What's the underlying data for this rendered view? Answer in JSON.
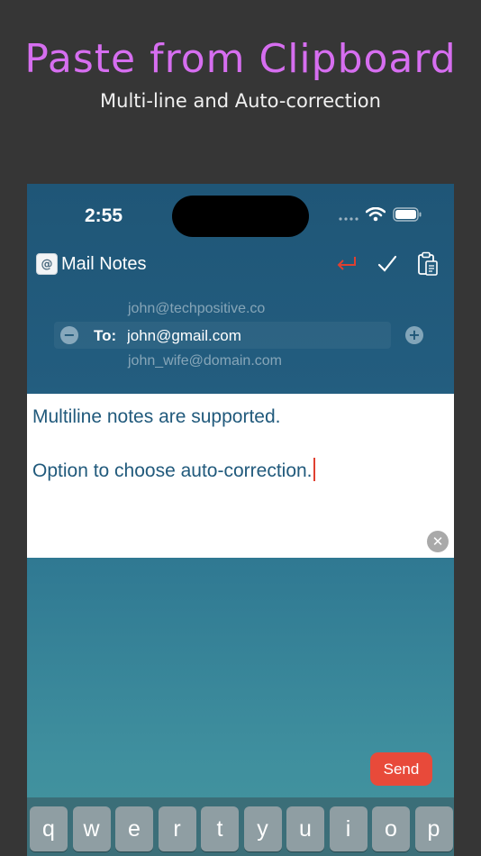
{
  "promo": {
    "title": "Paste from Clipboard",
    "subtitle": "Multi-line and Auto-correction"
  },
  "status_bar": {
    "time": "2:55",
    "icons": [
      "signal-dots-icon",
      "wifi-icon",
      "battery-icon"
    ]
  },
  "nav": {
    "app_title": "Mail Notes",
    "app_icon": "at-sign-icon",
    "buttons": [
      "return-arrow-icon",
      "checkmark-icon",
      "clipboard-paste-icon"
    ]
  },
  "recipients": {
    "above": "john@techpositive.co",
    "label": "To:",
    "current": "john@gmail.com",
    "below": "john_wife@domain.com"
  },
  "notes": {
    "line1": "Multiline notes are supported.",
    "line2": "Option to choose auto-correction."
  },
  "send_label": "Send",
  "keyboard": {
    "keys": [
      "q",
      "w",
      "e",
      "r",
      "t",
      "y",
      "u",
      "i",
      "o",
      "p"
    ]
  },
  "colors": {
    "accent_title": "#d66ef0",
    "send": "#e84a3a",
    "return_icon": "#e04030",
    "note_text": "#215a7c"
  }
}
